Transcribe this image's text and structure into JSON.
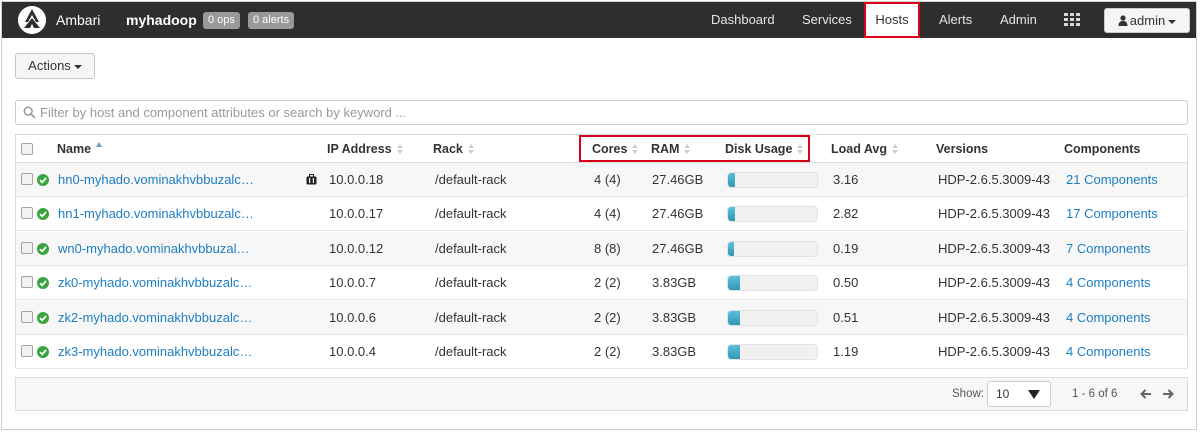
{
  "navbar": {
    "brand": "Ambari",
    "cluster": "myhadoop",
    "ops_badge": "0 ops",
    "alerts_badge": "0 alerts",
    "items": [
      {
        "label": "Dashboard",
        "active": false
      },
      {
        "label": "Services",
        "active": false
      },
      {
        "label": "Hosts",
        "active": true
      },
      {
        "label": "Alerts",
        "active": false
      },
      {
        "label": "Admin",
        "active": false
      }
    ],
    "apps_icon": "grid-icon",
    "user_icon": "user-icon",
    "user_menu": "admin"
  },
  "toolbar": {
    "actions_label": "Actions"
  },
  "filter": {
    "placeholder": "Filter by host and component attributes or search by keyword ..."
  },
  "table": {
    "columns": {
      "name": "Name",
      "ip": "IP Address",
      "rack": "Rack",
      "cores": "Cores",
      "ram": "RAM",
      "disk": "Disk Usage",
      "load": "Load Avg",
      "versions": "Versions",
      "components": "Components"
    },
    "rows": [
      {
        "name": "hn0-myhado.vominakhvbbuzalc…",
        "ip": "10.0.0.18",
        "rack": "/default-rack",
        "cores": "4 (4)",
        "ram": "27.46GB",
        "disk_pct": 8,
        "load": "3.16",
        "version": "HDP-2.6.5.3009-43",
        "components": "21 Components",
        "status": "healthy",
        "has_config_icon": true
      },
      {
        "name": "hn1-myhado.vominakhvbbuzalc…",
        "ip": "10.0.0.17",
        "rack": "/default-rack",
        "cores": "4 (4)",
        "ram": "27.46GB",
        "disk_pct": 8,
        "load": "2.82",
        "version": "HDP-2.6.5.3009-43",
        "components": "17 Components",
        "status": "healthy",
        "has_config_icon": false
      },
      {
        "name": "wn0-myhado.vominakhvbbuzal…",
        "ip": "10.0.0.12",
        "rack": "/default-rack",
        "cores": "8 (8)",
        "ram": "27.46GB",
        "disk_pct": 7,
        "load": "0.19",
        "version": "HDP-2.6.5.3009-43",
        "components": "7 Components",
        "status": "healthy",
        "has_config_icon": false
      },
      {
        "name": "zk0-myhado.vominakhvbbuzalc…",
        "ip": "10.0.0.7",
        "rack": "/default-rack",
        "cores": "2 (2)",
        "ram": "3.83GB",
        "disk_pct": 13,
        "load": "0.50",
        "version": "HDP-2.6.5.3009-43",
        "components": "4 Components",
        "status": "healthy",
        "has_config_icon": false
      },
      {
        "name": "zk2-myhado.vominakhvbbuzalc…",
        "ip": "10.0.0.6",
        "rack": "/default-rack",
        "cores": "2 (2)",
        "ram": "3.83GB",
        "disk_pct": 13,
        "load": "0.51",
        "version": "HDP-2.6.5.3009-43",
        "components": "4 Components",
        "status": "healthy",
        "has_config_icon": false
      },
      {
        "name": "zk3-myhado.vominakhvbbuzalc…",
        "ip": "10.0.0.4",
        "rack": "/default-rack",
        "cores": "2 (2)",
        "ram": "3.83GB",
        "disk_pct": 13,
        "load": "1.19",
        "version": "HDP-2.6.5.3009-43",
        "components": "4 Components",
        "status": "healthy",
        "has_config_icon": false
      }
    ]
  },
  "footer": {
    "show_label": "Show:",
    "page_size": "10",
    "range": "1 - 6 of 6"
  },
  "colors": {
    "navbar": "#2e2e2e",
    "link": "#1d7ec2",
    "healthy": "#3aa53f",
    "disk_bar": "#2f96b4",
    "highlight": "#d9001b"
  }
}
